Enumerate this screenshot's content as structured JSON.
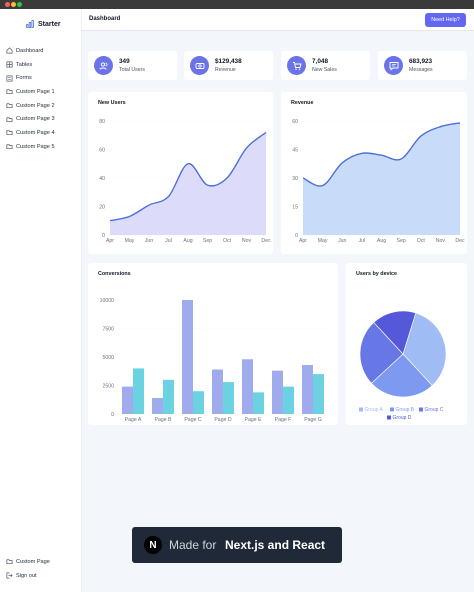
{
  "window": {
    "controls": [
      "close",
      "minimize",
      "zoom"
    ],
    "colors": {
      "close": "#ff5f57",
      "minimize": "#febc2e",
      "zoom": "#28c840"
    }
  },
  "sidebar": {
    "brand": "Starter",
    "brand_icon": "bar-chart-icon",
    "items": [
      {
        "label": "Dashboard",
        "icon": "home-icon"
      },
      {
        "label": "Tables",
        "icon": "table-icon"
      },
      {
        "label": "Forms",
        "icon": "form-icon"
      },
      {
        "label": "Custom Page 1",
        "icon": "folder-icon"
      },
      {
        "label": "Custom Page 2",
        "icon": "folder-icon"
      },
      {
        "label": "Custom Page 3",
        "icon": "folder-icon"
      },
      {
        "label": "Custom Page 4",
        "icon": "folder-icon"
      },
      {
        "label": "Custom Page 5",
        "icon": "folder-icon"
      }
    ],
    "bottom_items": [
      {
        "label": "Custom Page",
        "icon": "folder-icon"
      },
      {
        "label": "Sign out",
        "icon": "sign-out-icon"
      }
    ]
  },
  "header": {
    "title": "Dashboard",
    "help_button": "Need Help?"
  },
  "stats": [
    {
      "value": "349",
      "label": "Total Users",
      "icon": "users-icon"
    },
    {
      "value": "$129,438",
      "label": "Revenue",
      "icon": "money-icon"
    },
    {
      "value": "7,048",
      "label": "New Sales",
      "icon": "cart-icon"
    },
    {
      "value": "683,923",
      "label": "Messages",
      "icon": "message-icon"
    }
  ],
  "colors": {
    "accent": "#6366f1",
    "icon_bg": "#6b74e6",
    "line": "#4f6fd8",
    "area_users": "#dcdcfa",
    "area_revenue": "#c8dcfa",
    "bar_a": "#a0abee",
    "bar_b": "#6bd2e2"
  },
  "chart_data": [
    {
      "type": "area",
      "title": "New Users",
      "categories": [
        "Apr",
        "May",
        "Jun",
        "Jul",
        "Aug",
        "Sep",
        "Oct",
        "Nov",
        "Dec"
      ],
      "values": [
        10,
        13,
        21,
        27,
        50,
        35,
        40,
        61,
        72
      ],
      "yticks": [
        0,
        20,
        40,
        60,
        80
      ],
      "ylim": [
        0,
        80
      ]
    },
    {
      "type": "area",
      "title": "Revenue",
      "categories": [
        "Apr",
        "May",
        "Jun",
        "Jul",
        "Aug",
        "Sep",
        "Oct",
        "Nov",
        "Dec"
      ],
      "values": [
        30,
        26,
        38,
        43,
        42,
        40,
        52,
        57,
        59
      ],
      "yticks": [
        0,
        15,
        30,
        45,
        60
      ],
      "ylim": [
        0,
        60
      ]
    },
    {
      "type": "bar",
      "title": "Conversions",
      "categories": [
        "Page A",
        "Page B",
        "Page C",
        "Page D",
        "Page E",
        "Page F",
        "Page G"
      ],
      "series": [
        {
          "values": [
            2400,
            1400,
            10000,
            3900,
            4800,
            3800,
            4300
          ]
        },
        {
          "values": [
            4000,
            3000,
            2000,
            2800,
            1900,
            2400,
            3500
          ]
        }
      ],
      "yticks": [
        0,
        2500,
        5000,
        7500,
        10000
      ],
      "ylim": [
        0,
        10000
      ]
    },
    {
      "type": "pie",
      "title": "Users by device",
      "series": [
        {
          "name": "Group A",
          "value": 400,
          "color": "#a0bcf5"
        },
        {
          "name": "Group B",
          "value": 300,
          "color": "#7d9af0"
        },
        {
          "name": "Group C",
          "value": 300,
          "color": "#6877e6"
        },
        {
          "name": "Group D",
          "value": 200,
          "color": "#5558d8"
        }
      ],
      "legend": "bottom"
    }
  ],
  "banner": {
    "prefix": "Made for",
    "emphasis": "Next.js and React",
    "logo_letter": "N"
  }
}
